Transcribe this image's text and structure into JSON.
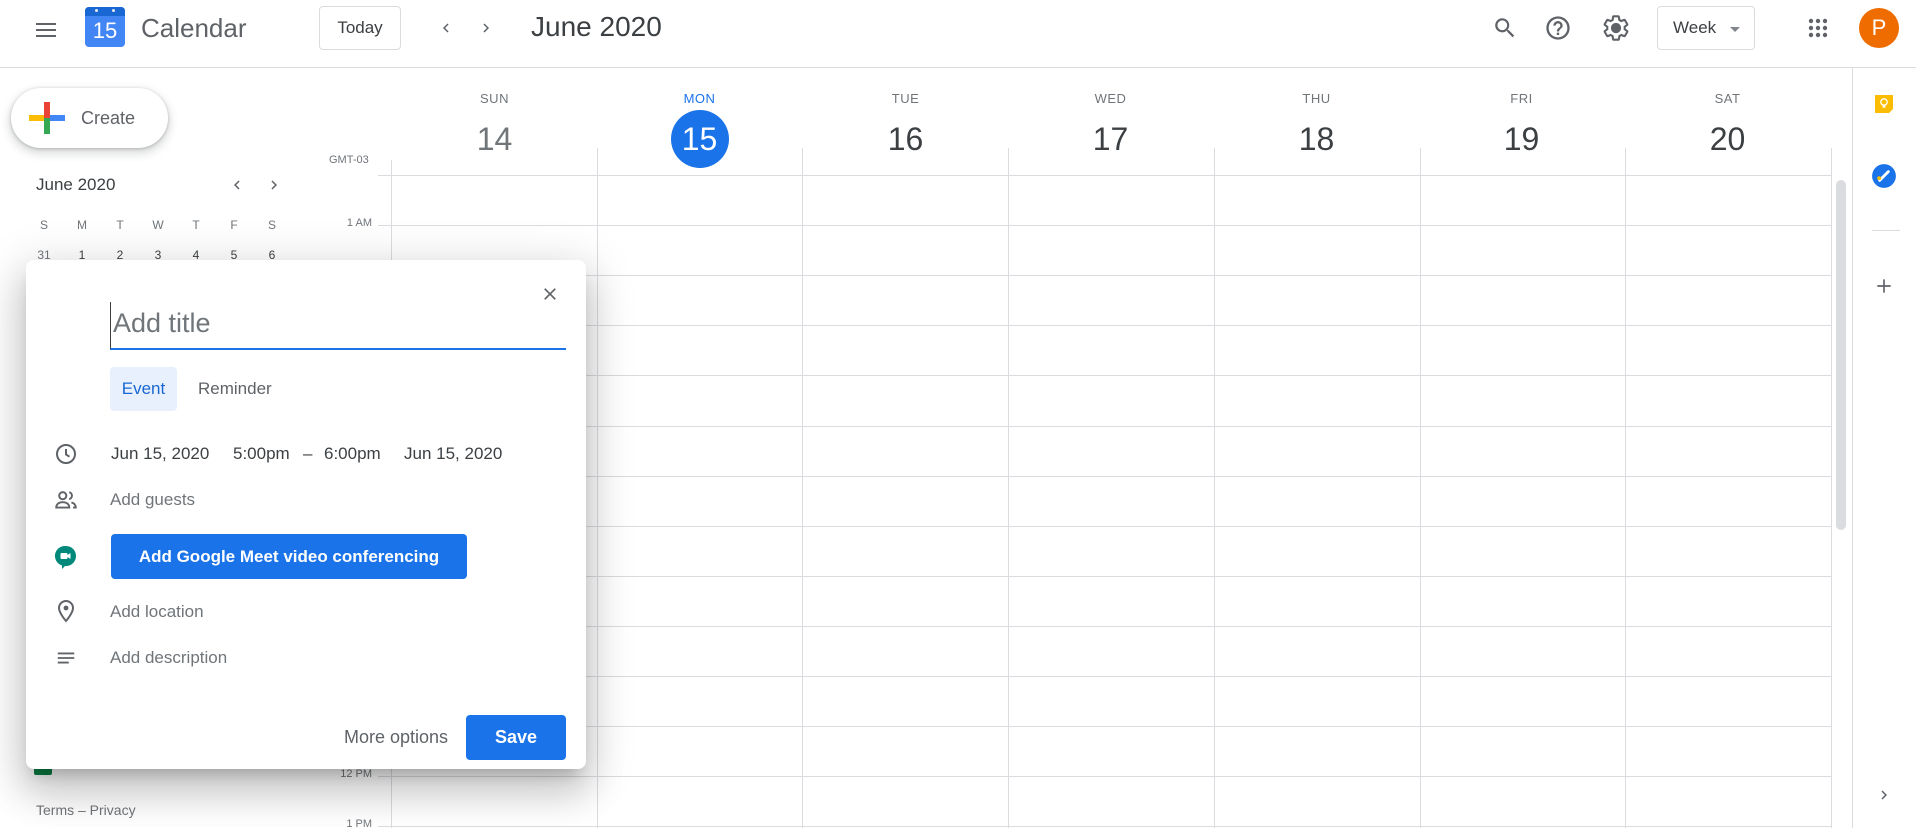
{
  "header": {
    "app_name": "Calendar",
    "logo_day": "15",
    "today_label": "Today",
    "period_title": "June 2020",
    "view_select": "Week",
    "avatar_initial": "P",
    "icons": [
      "menu-icon",
      "prev-chevron-icon",
      "next-chevron-icon",
      "search-icon",
      "help-icon",
      "settings-icon",
      "apps-grid-icon"
    ]
  },
  "sidebar": {
    "create_label": "Create",
    "mini_calendar": {
      "title": "June 2020",
      "weekdays": [
        "S",
        "M",
        "T",
        "W",
        "T",
        "F",
        "S"
      ],
      "visible_dates": [
        "31",
        "1",
        "2",
        "3",
        "4",
        "5",
        "6"
      ]
    },
    "footer": "Terms – Privacy"
  },
  "week": {
    "timezone": "GMT-03",
    "days": [
      {
        "dow": "SUN",
        "date": "14"
      },
      {
        "dow": "MON",
        "date": "15",
        "today": true
      },
      {
        "dow": "TUE",
        "date": "16"
      },
      {
        "dow": "WED",
        "date": "17"
      },
      {
        "dow": "THU",
        "date": "18"
      },
      {
        "dow": "FRI",
        "date": "19"
      },
      {
        "dow": "SAT",
        "date": "20"
      }
    ],
    "hour_labels": {
      "h1": "1 AM",
      "h12": "12 PM",
      "h13": "1 PM"
    }
  },
  "dialog": {
    "title_placeholder": "Add title",
    "tabs": {
      "event": "Event",
      "reminder": "Reminder"
    },
    "start_date": "Jun 15, 2020",
    "start_time": "5:00pm",
    "separator": "–",
    "end_time": "6:00pm",
    "end_date": "Jun 15, 2020",
    "guests": "Add guests",
    "meet_button": "Add Google Meet video conferencing",
    "location": "Add location",
    "description": "Add description",
    "more_options": "More options",
    "save": "Save"
  },
  "colors": {
    "accent": "#1a73e8",
    "avatar": "#ef6c00",
    "meet_icon": "#00897b",
    "keep_icon": "#fbbc04"
  }
}
